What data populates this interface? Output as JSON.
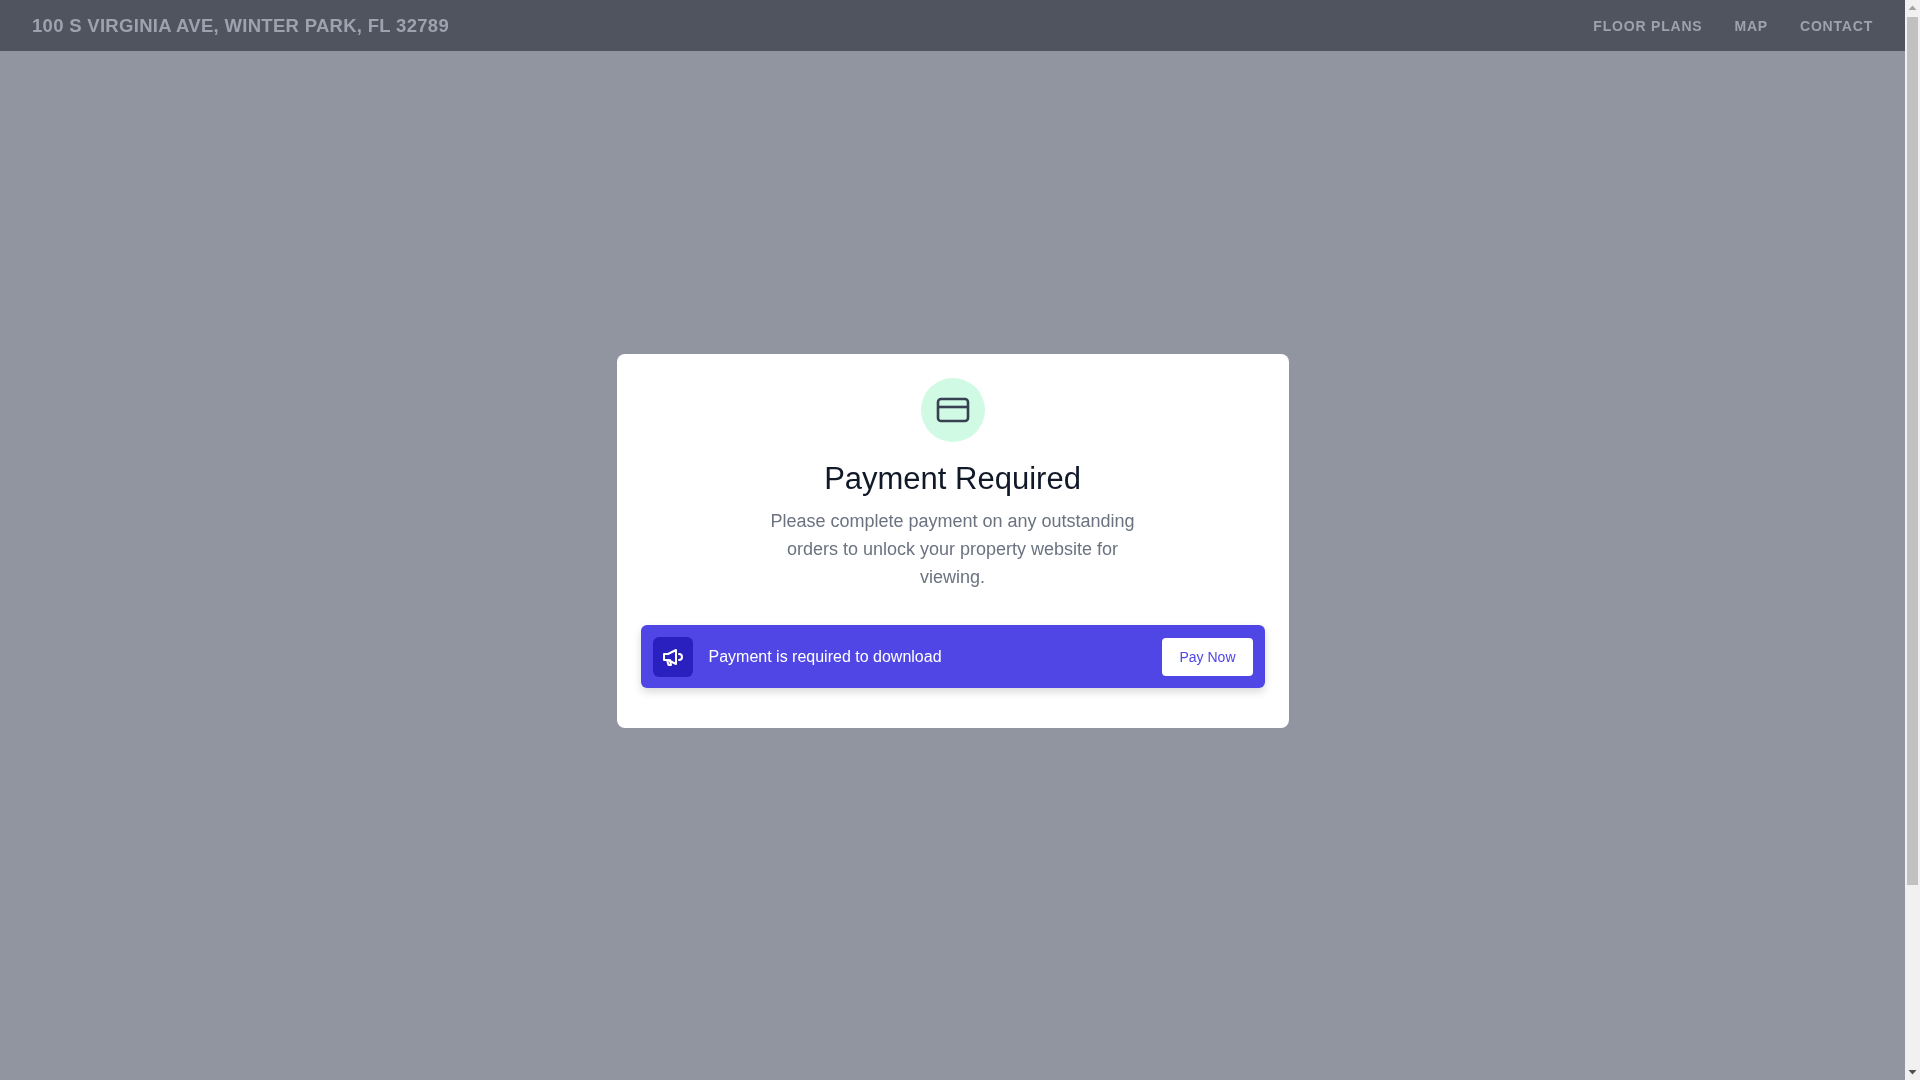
{
  "header": {
    "title": "100 S VIRGINIA AVE, WINTER PARK, FL 32789",
    "nav": [
      "FLOOR PLANS",
      "MAP",
      "CONTACT"
    ]
  },
  "dialog": {
    "title": "Payment Required",
    "message": "Please complete payment on any outstanding orders to unlock your property website for viewing.",
    "banner": {
      "text": "Payment is required to download",
      "button": "Pay Now"
    }
  }
}
